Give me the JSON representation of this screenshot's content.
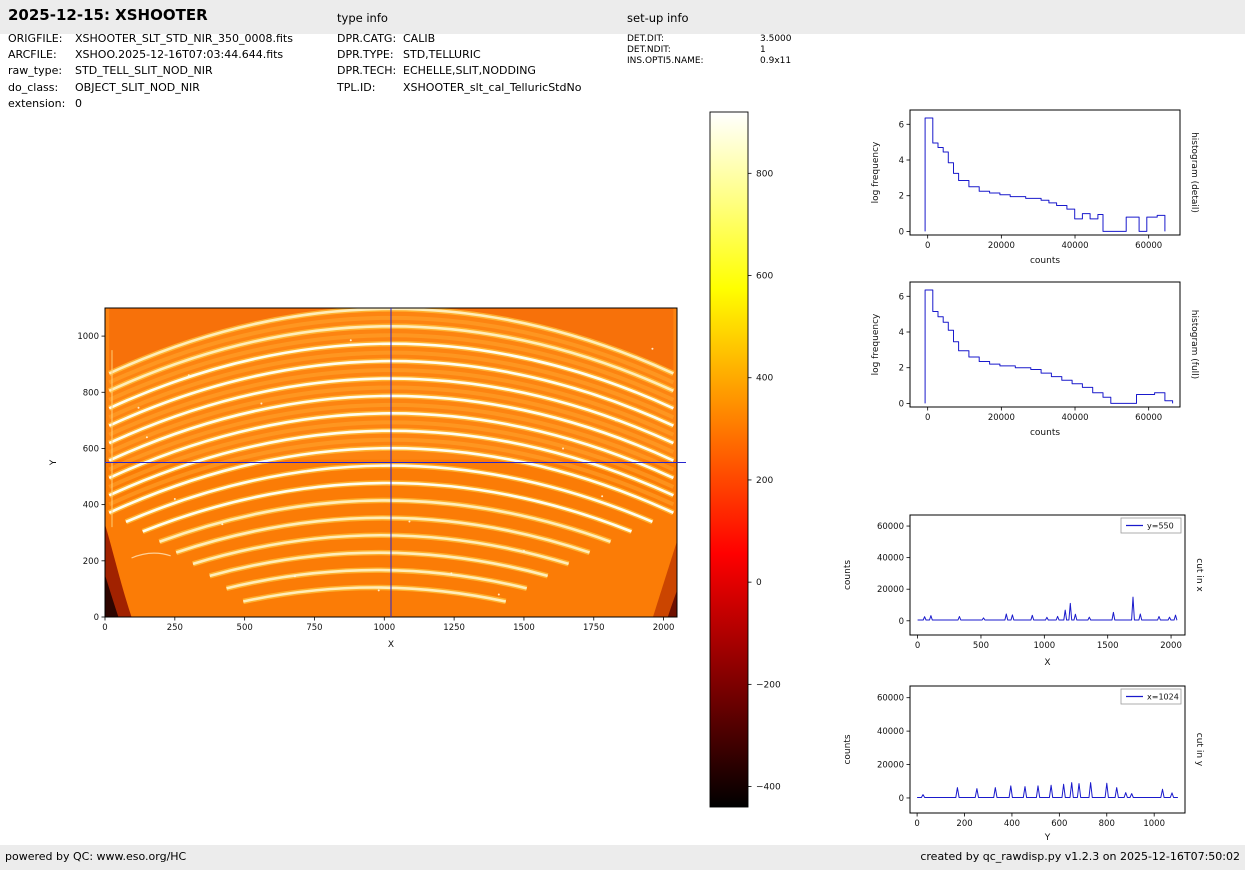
{
  "header": {
    "title": "2025-12-15: XSHOOTER",
    "type_info_label": "type info",
    "setup_info_label": "set-up info"
  },
  "file_info": {
    "rows": [
      {
        "label": "ORIGFILE:",
        "value": "XSHOOTER_SLT_STD_NIR_350_0008.fits"
      },
      {
        "label": "ARCFILE:",
        "value": "XSHOO.2025-12-16T07:03:44.644.fits"
      },
      {
        "label": "raw_type:",
        "value": "STD_TELL_SLIT_NOD_NIR"
      },
      {
        "label": "do_class:",
        "value": "OBJECT_SLIT_NOD_NIR"
      },
      {
        "label": "extension:",
        "value": "0"
      }
    ]
  },
  "type_info": {
    "rows": [
      {
        "label": "DPR.CATG:",
        "value": "CALIB"
      },
      {
        "label": "DPR.TYPE:",
        "value": "STD,TELLURIC"
      },
      {
        "label": "DPR.TECH:",
        "value": "ECHELLE,SLIT,NODDING"
      },
      {
        "label": "TPL.ID:",
        "value": "XSHOOTER_slt_cal_TelluricStdNo"
      }
    ]
  },
  "setup_info": {
    "rows": [
      {
        "label": "DET.DIT:",
        "value": "3.5000"
      },
      {
        "label": "DET.NDIT:",
        "value": "1"
      },
      {
        "label": "INS.OPTI5.NAME:",
        "value": "0.9x11"
      }
    ]
  },
  "footer": {
    "left": "powered by QC: www.eso.org/HC",
    "right": "created by qc_rawdisp.py v1.2.3 on 2025-12-16T07:50:02"
  },
  "colors": {
    "line": "#1a1acc",
    "crosshair": "#2727cf"
  },
  "chart_data": [
    {
      "id": "main-image",
      "type": "heatmap",
      "description": "raw NIR echelle frame, curved spectral orders on hot colormap",
      "xlabel": "X",
      "ylabel": "Y",
      "xlim": [
        0,
        2048
      ],
      "ylim": [
        0,
        1100
      ],
      "xticks": [
        0,
        250,
        500,
        750,
        1000,
        1250,
        1500,
        1750,
        2000
      ],
      "yticks": [
        0,
        200,
        400,
        600,
        800,
        1000
      ],
      "crosshair": {
        "x": 1024,
        "y": 550
      },
      "orders": {
        "count": 17,
        "peak_x": 1000,
        "top_peak_y": 1035,
        "spacing": 62,
        "edge_drop": 230
      }
    },
    {
      "id": "colorbar",
      "type": "colorbar",
      "colormap": "hot",
      "vmin": -440,
      "vmax": 920,
      "ticks": [
        800,
        600,
        400,
        200,
        0,
        -200,
        -400
      ]
    },
    {
      "id": "hist-detail",
      "type": "line",
      "xlabel": "counts",
      "ylabel": "log frequency",
      "side_label": "histogram (detail)",
      "xlim": [
        -4800,
        68500
      ],
      "ylim": [
        -0.2,
        6.8
      ],
      "xticks": [
        0,
        20000,
        40000,
        60000
      ],
      "yticks": [
        0,
        2,
        4,
        6
      ],
      "points": [
        [
          -700,
          0
        ],
        [
          -700,
          6.35
        ],
        [
          1400,
          6.35
        ],
        [
          1400,
          4.95
        ],
        [
          2800,
          4.95
        ],
        [
          2800,
          4.7
        ],
        [
          4200,
          4.7
        ],
        [
          4200,
          4.45
        ],
        [
          5600,
          4.45
        ],
        [
          5600,
          3.85
        ],
        [
          7000,
          3.85
        ],
        [
          7000,
          3.25
        ],
        [
          8400,
          3.25
        ],
        [
          8400,
          2.85
        ],
        [
          11200,
          2.85
        ],
        [
          11200,
          2.5
        ],
        [
          14000,
          2.5
        ],
        [
          14000,
          2.25
        ],
        [
          16800,
          2.25
        ],
        [
          16800,
          2.15
        ],
        [
          19600,
          2.15
        ],
        [
          19600,
          2.05
        ],
        [
          22400,
          2.05
        ],
        [
          22400,
          1.95
        ],
        [
          26600,
          1.95
        ],
        [
          26600,
          1.85
        ],
        [
          30800,
          1.85
        ],
        [
          30800,
          1.75
        ],
        [
          32900,
          1.75
        ],
        [
          32900,
          1.6
        ],
        [
          35000,
          1.6
        ],
        [
          35000,
          1.45
        ],
        [
          37800,
          1.45
        ],
        [
          37800,
          1.25
        ],
        [
          39900,
          1.25
        ],
        [
          39900,
          0.7
        ],
        [
          42000,
          0.7
        ],
        [
          42000,
          1.0
        ],
        [
          44100,
          1.0
        ],
        [
          44100,
          0.7
        ],
        [
          46200,
          0.7
        ],
        [
          46200,
          0.95
        ],
        [
          47600,
          0.95
        ],
        [
          47600,
          0
        ],
        [
          53900,
          0
        ],
        [
          53900,
          0.8
        ],
        [
          57400,
          0.8
        ],
        [
          57400,
          0
        ],
        [
          59500,
          0
        ],
        [
          59500,
          0.8
        ],
        [
          62300,
          0.8
        ],
        [
          62300,
          0.9
        ],
        [
          64400,
          0.9
        ],
        [
          64400,
          0
        ]
      ]
    },
    {
      "id": "hist-full",
      "type": "line",
      "xlabel": "counts",
      "ylabel": "log frequency",
      "side_label": "histogram (full)",
      "xlim": [
        -4800,
        68500
      ],
      "ylim": [
        -0.2,
        6.8
      ],
      "xticks": [
        0,
        20000,
        40000,
        60000
      ],
      "yticks": [
        0,
        2,
        4,
        6
      ],
      "points": [
        [
          -700,
          0
        ],
        [
          -700,
          6.35
        ],
        [
          1400,
          6.35
        ],
        [
          1400,
          5.15
        ],
        [
          2800,
          5.15
        ],
        [
          2800,
          4.85
        ],
        [
          4200,
          4.85
        ],
        [
          4200,
          4.55
        ],
        [
          5600,
          4.55
        ],
        [
          5600,
          4.1
        ],
        [
          7000,
          4.1
        ],
        [
          7000,
          3.45
        ],
        [
          8400,
          3.45
        ],
        [
          8400,
          2.95
        ],
        [
          11200,
          2.95
        ],
        [
          11200,
          2.6
        ],
        [
          14000,
          2.6
        ],
        [
          14000,
          2.35
        ],
        [
          16800,
          2.35
        ],
        [
          16800,
          2.2
        ],
        [
          19600,
          2.2
        ],
        [
          19600,
          2.1
        ],
        [
          23800,
          2.1
        ],
        [
          23800,
          2.0
        ],
        [
          28000,
          2.0
        ],
        [
          28000,
          1.9
        ],
        [
          30800,
          1.9
        ],
        [
          30800,
          1.7
        ],
        [
          33600,
          1.7
        ],
        [
          33600,
          1.5
        ],
        [
          36400,
          1.5
        ],
        [
          36400,
          1.3
        ],
        [
          39200,
          1.3
        ],
        [
          39200,
          1.1
        ],
        [
          42000,
          1.1
        ],
        [
          42000,
          0.9
        ],
        [
          44800,
          0.9
        ],
        [
          44800,
          0.6
        ],
        [
          47600,
          0.6
        ],
        [
          47600,
          0.35
        ],
        [
          49700,
          0.35
        ],
        [
          49700,
          0
        ],
        [
          56700,
          0
        ],
        [
          56700,
          0.5
        ],
        [
          61600,
          0.5
        ],
        [
          61600,
          0.6
        ],
        [
          64400,
          0.6
        ],
        [
          64400,
          0.15
        ],
        [
          66500,
          0.15
        ],
        [
          66500,
          0
        ]
      ]
    },
    {
      "id": "cut-x",
      "type": "line",
      "xlabel": "X",
      "ylabel": "counts",
      "side_label": "cut in x",
      "legend": "y=550",
      "xlim": [
        -60,
        2110
      ],
      "ylim": [
        -9000,
        67000
      ],
      "xrange": [
        0,
        2048
      ],
      "xticks": [
        0,
        500,
        1000,
        1500,
        2000
      ],
      "yticks": [
        0,
        20000,
        40000,
        60000
      ],
      "baseline": 500,
      "spike_halfwidth": 11,
      "spikes": [
        [
          55,
          2600
        ],
        [
          105,
          3300
        ],
        [
          330,
          2700
        ],
        [
          520,
          1800
        ],
        [
          700,
          4300
        ],
        [
          748,
          3700
        ],
        [
          905,
          3500
        ],
        [
          1020,
          2200
        ],
        [
          1105,
          2800
        ],
        [
          1165,
          6800
        ],
        [
          1205,
          11000
        ],
        [
          1245,
          4200
        ],
        [
          1355,
          2300
        ],
        [
          1545,
          5300
        ],
        [
          1700,
          15000
        ],
        [
          1757,
          4300
        ],
        [
          1905,
          2700
        ],
        [
          1988,
          2300
        ],
        [
          2035,
          3600
        ]
      ]
    },
    {
      "id": "cut-y",
      "type": "line",
      "xlabel": "Y",
      "ylabel": "counts",
      "side_label": "cut in y",
      "legend": "x=1024",
      "xlim": [
        -30,
        1130
      ],
      "ylim": [
        -9000,
        67000
      ],
      "xrange": [
        0,
        1100
      ],
      "xticks": [
        0,
        200,
        400,
        600,
        800,
        1000
      ],
      "yticks": [
        0,
        20000,
        40000,
        60000
      ],
      "baseline": 250,
      "spike_halfwidth": 7,
      "spikes": [
        [
          25,
          2000
        ],
        [
          170,
          6200
        ],
        [
          252,
          5600
        ],
        [
          330,
          6200
        ],
        [
          395,
          7200
        ],
        [
          455,
          6800
        ],
        [
          510,
          7200
        ],
        [
          565,
          7600
        ],
        [
          618,
          8200
        ],
        [
          652,
          9200
        ],
        [
          683,
          8600
        ],
        [
          732,
          9200
        ],
        [
          800,
          8800
        ],
        [
          842,
          6200
        ],
        [
          880,
          3200
        ],
        [
          905,
          2600
        ],
        [
          1035,
          5200
        ],
        [
          1075,
          3000
        ]
      ]
    }
  ]
}
